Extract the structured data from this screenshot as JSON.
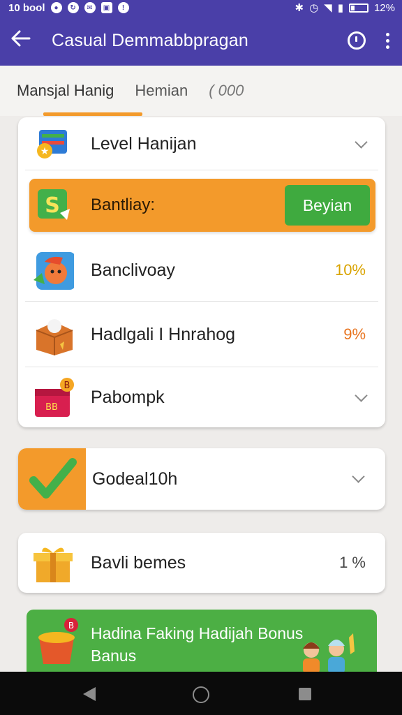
{
  "status_bar": {
    "left_text": "10 bool",
    "battery": "12%",
    "icons": [
      "notification-icon",
      "sync-icon",
      "message-icon",
      "photo-icon",
      "info-icon",
      "bluetooth-icon",
      "alarm-icon",
      "wifi-icon",
      "signal-icon",
      "battery-icon"
    ]
  },
  "app_bar": {
    "title": "Casual Demmabbpragan",
    "back_icon": "back-arrow-icon",
    "action_icon": "help-search-icon",
    "menu_icon": "more-vert-icon"
  },
  "tabs": [
    {
      "label": "Mansjal Hanig",
      "active": true
    },
    {
      "label": "Hemian",
      "active": false
    },
    {
      "label": "( 000",
      "active": false
    }
  ],
  "card1": {
    "rows": [
      {
        "label": "Level Hanijan",
        "icon": "level-icon",
        "trailing": "chevron"
      },
      {
        "label": "Banclivoay",
        "icon": "avatar-fox-icon",
        "value": "10%"
      },
      {
        "label": "Hadlgali I Hnrahog",
        "icon": "gift-box-icon",
        "value": "9%"
      },
      {
        "label": "Pabompk",
        "icon": "red-gift-icon",
        "trailing": "chevron"
      }
    ],
    "promo": {
      "label": "Bantliay:",
      "button": "Beyian",
      "icon": "dollar-icon"
    }
  },
  "card2": {
    "label": "Godeal10h",
    "icon": "checkmark-icon"
  },
  "card3": {
    "label": "Bavli bemes",
    "value": "1 %",
    "icon": "yellow-gift-icon"
  },
  "banner": {
    "text": "Hadina Faking Hadijah Bonus Banus",
    "icon": "treasure-pot-icon"
  },
  "colors": {
    "primary": "#4a3fa8",
    "accent": "#f39a2b",
    "green": "#4caf44",
    "yellow_pct": "#d9a300",
    "orange_pct": "#e8741f"
  }
}
